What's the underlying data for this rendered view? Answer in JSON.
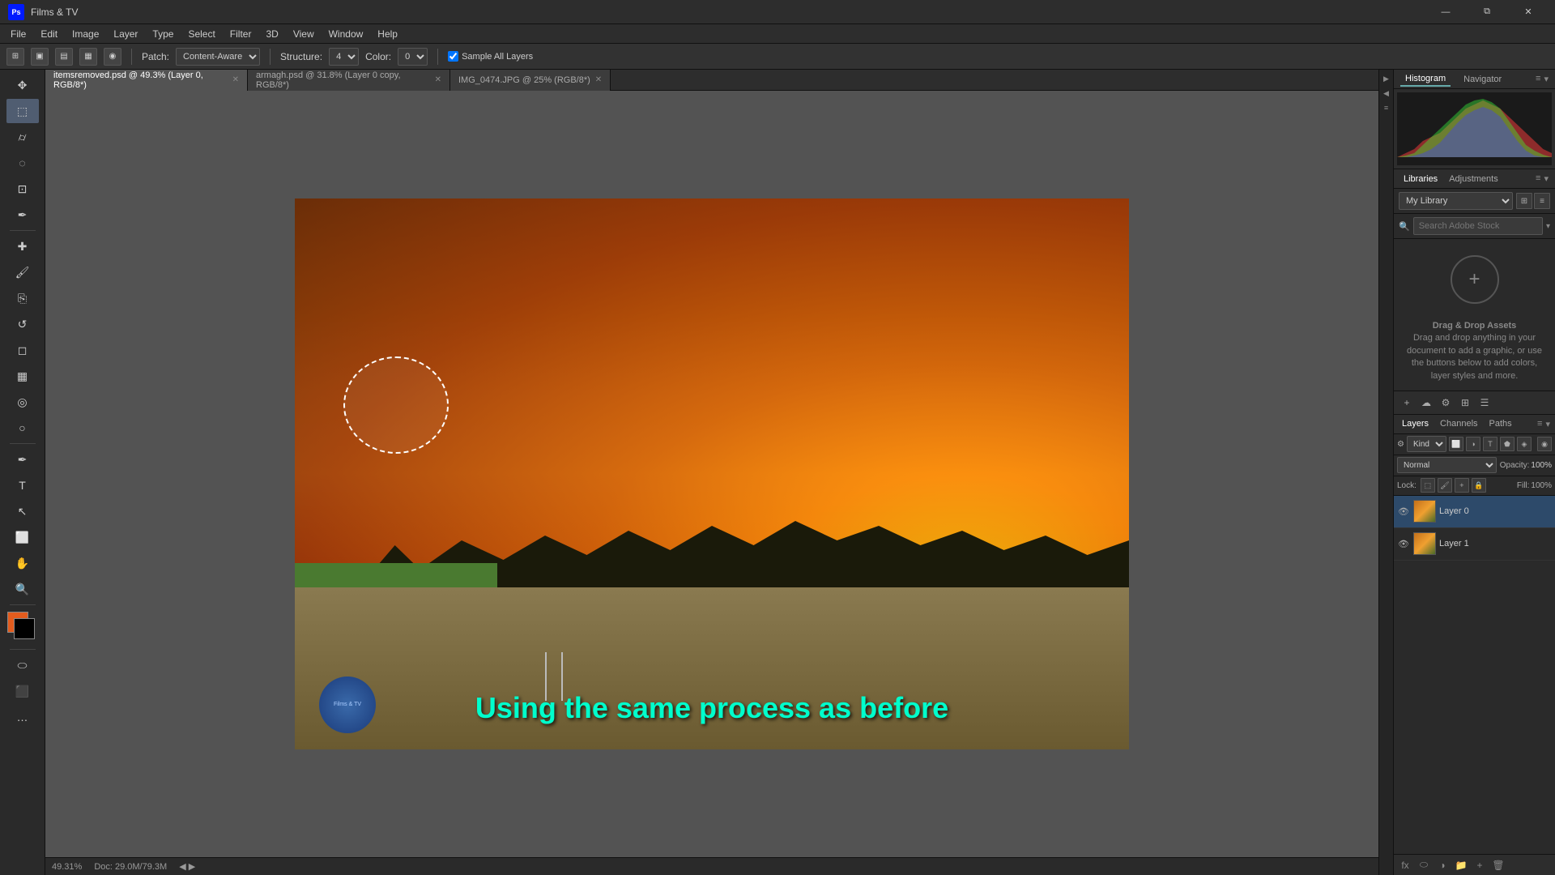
{
  "titleBar": {
    "appName": "Films & TV",
    "psLogo": "Ps",
    "minimize": "—",
    "maximize": "❐",
    "close": "✕",
    "restoreDown": "⧉"
  },
  "menuBar": {
    "items": [
      "File",
      "Edit",
      "Image",
      "Layer",
      "Type",
      "Select",
      "Filter",
      "3D",
      "View",
      "Window",
      "Help"
    ]
  },
  "optionsBar": {
    "patch": "Patch:",
    "patchMode": "Content-Aware",
    "structure": "Structure:",
    "structureVal": "4",
    "color": "Color:",
    "colorVal": "0",
    "sampleAll": "Sample All Layers"
  },
  "tabs": [
    {
      "label": "itemsremoved.psd @ 49.3% (Layer 0, RGB/8*)",
      "active": true
    },
    {
      "label": "armagh.psd @ 31.8% (Layer 0 copy, RGB/8*)",
      "active": false
    },
    {
      "label": "IMG_0474.JPG @ 25% (RGB/8*)",
      "active": false
    }
  ],
  "statusBar": {
    "zoom": "49.31%",
    "docSize": "Doc: 29.0M/79.3M"
  },
  "canvas": {
    "caption": "Using the same process as before"
  },
  "rightPanel": {
    "histogramTab": "Histogram",
    "navigatorTab": "Navigator",
    "librariesTab": "Libraries",
    "adjustmentsTab": "Adjustments",
    "libraryDropdown": "My Library",
    "searchPlaceholder": "Search Adobe Stock",
    "dragDropText": "Drag & Drop Assets",
    "dragDropDesc": "Drag and drop anything in your document to add a graphic, or use the buttons below to add colors, layer styles and more.",
    "layersTab": "Layers",
    "channelsTab": "Channels",
    "pathsTab": "Paths",
    "filterKind": "Kind",
    "blendMode": "Normal",
    "opacity": "100%",
    "fill": "100%",
    "lock": "Lock:",
    "layers": [
      {
        "name": "Layer 0",
        "active": true
      },
      {
        "name": "Layer 1",
        "active": false
      }
    ]
  }
}
